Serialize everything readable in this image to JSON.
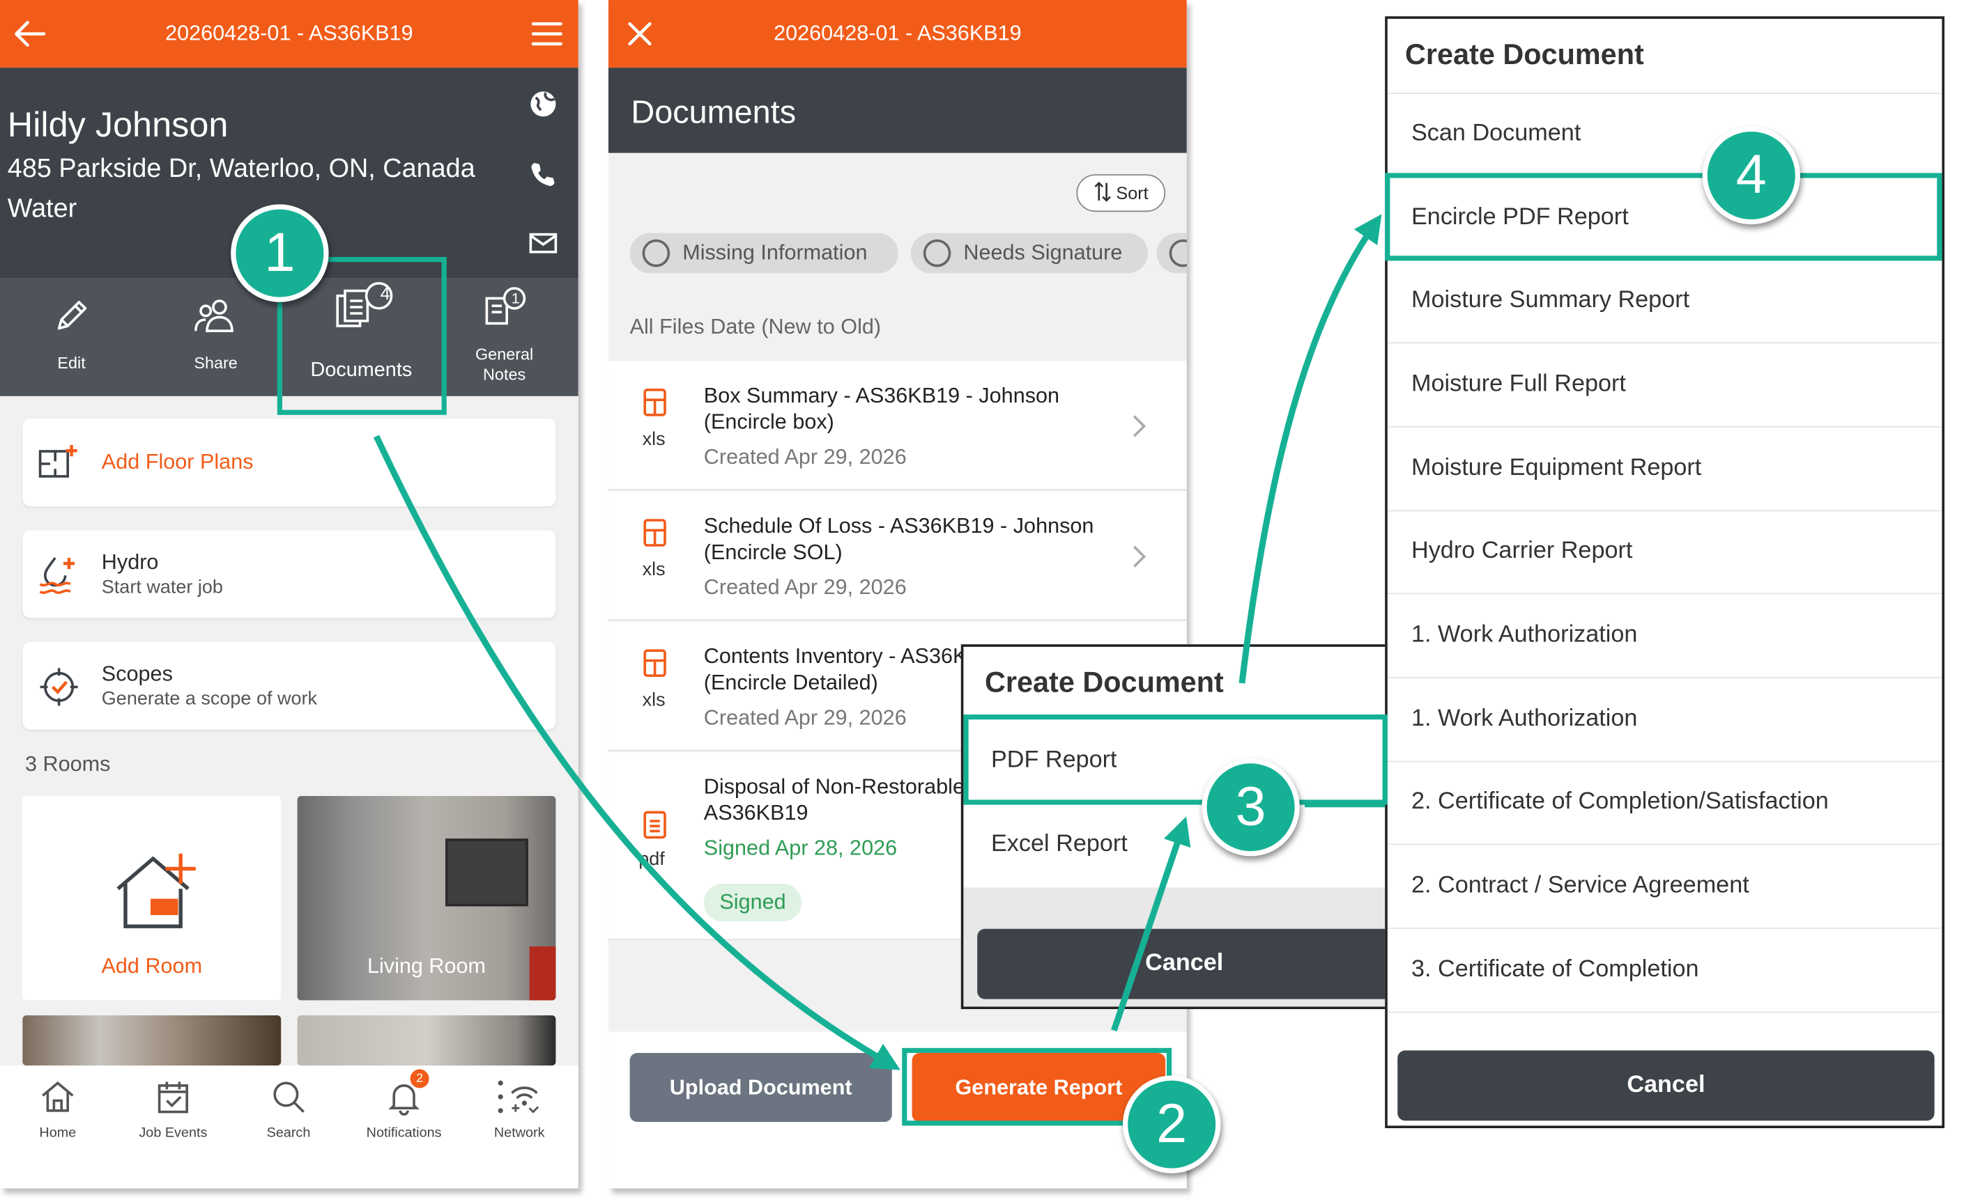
{
  "job_id": "20260428-01 - AS36KB19",
  "job": {
    "customer": "Hildy Johnson",
    "address": "485 Parkside Dr, Waterloo, ON, Canada",
    "loss_type": "Water"
  },
  "actions": {
    "edit": "Edit",
    "share": "Share",
    "documents": "Documents",
    "documents_count": "4",
    "general_notes": "General Notes",
    "general_notes_count": "1"
  },
  "cards": {
    "floor_plans": "Add Floor Plans",
    "hydro_title": "Hydro",
    "hydro_sub": "Start water job",
    "scopes_title": "Scopes",
    "scopes_sub": "Generate a scope of work"
  },
  "rooms": {
    "count_label": "3 Rooms",
    "add_room": "Add Room",
    "living_room": "Living Room"
  },
  "nav": {
    "home": "Home",
    "job_events": "Job Events",
    "search": "Search",
    "notifications": "Notifications",
    "notifications_count": "2",
    "network": "Network"
  },
  "documents": {
    "title": "Documents",
    "sort": "Sort",
    "filters": [
      "Missing Information",
      "Needs Signature"
    ],
    "list_label": "All Files Date (New to Old)",
    "files": [
      {
        "name": "Box Summary - AS36KB19 - Johnson (Encircle box)",
        "ext": "xls",
        "date": "Created Apr 29, 2026"
      },
      {
        "name": "Schedule Of Loss - AS36KB19 - Johnson (Encircle SOL)",
        "ext": "xls",
        "date": "Created Apr 29, 2026"
      },
      {
        "name": "Contents Inventory - AS36KB19 - Johnson (Encircle Detailed)",
        "ext": "xls",
        "date": "Created Apr 29, 2026"
      },
      {
        "name": "Disposal of Non-Restorable 20260428-01 - AS36KB19",
        "ext": "pdf",
        "date": "Signed Apr 28, 2026",
        "badge": "Signed"
      }
    ],
    "upload_button": "Upload Document",
    "generate_button": "Generate Report"
  },
  "popup_small": {
    "title": "Create Document",
    "items": [
      "PDF Report",
      "Excel Report"
    ],
    "cancel": "Cancel"
  },
  "popup_large": {
    "title": "Create Document",
    "items": [
      "Scan Document",
      "Encircle PDF Report",
      "Moisture Summary Report",
      "Moisture Full Report",
      "Moisture Equipment Report",
      "Hydro Carrier Report",
      "1. Work Authorization",
      "1. Work Authorization",
      "2. Certificate of Completion/Satisfaction",
      "2. Contract / Service Agreement",
      "3. Certificate of Completion"
    ],
    "cancel": "Cancel"
  },
  "step_badges": [
    "1",
    "2",
    "3",
    "4"
  ],
  "colors": {
    "brand_orange": "#f25c19",
    "header_dark": "#3e434a",
    "highlight_teal": "#16b195",
    "signed_green": "#2f9c55"
  }
}
